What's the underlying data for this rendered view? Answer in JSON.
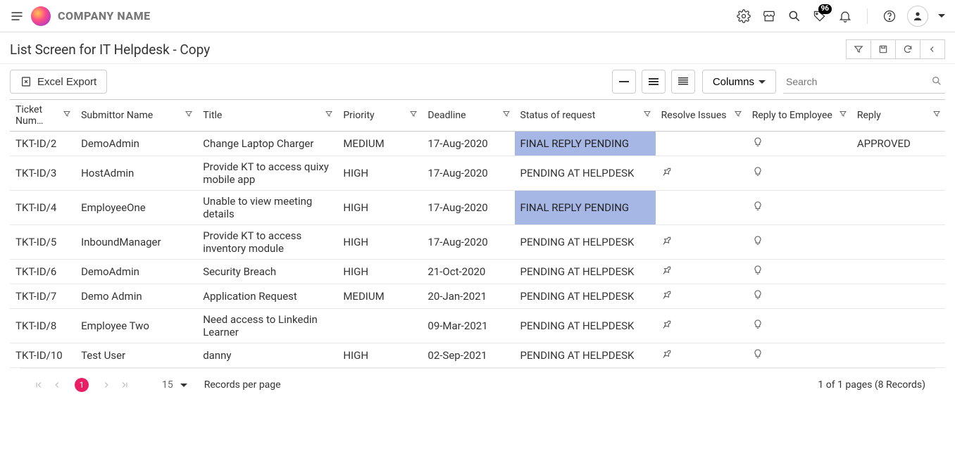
{
  "header": {
    "company": "COMPANY NAME",
    "notification_count": "96"
  },
  "page": {
    "title": "List Screen for IT Helpdesk - Copy"
  },
  "toolbar": {
    "excel_export_label": "Excel Export",
    "columns_label": "Columns",
    "search_placeholder": "Search"
  },
  "columns": {
    "ticket": "Ticket Num…",
    "submitter": "Submittor Name",
    "title": "Title",
    "priority": "Priority",
    "deadline": "Deadline",
    "status": "Status of request",
    "resolve": "Resolve Issues",
    "reply_emp": "Reply to Employee",
    "reply": "Reply"
  },
  "rows": [
    {
      "ticket": "TKT-ID/2",
      "submitter": "DemoAdmin",
      "title": "Change Laptop Charger",
      "priority": "MEDIUM",
      "deadline": "17-Aug-2020",
      "status": "FINAL REPLY PENDING",
      "status_hl": true,
      "pin": false,
      "bulb": true,
      "reply": "APPROVED",
      "two_line": false
    },
    {
      "ticket": "TKT-ID/3",
      "submitter": "HostAdmin",
      "title": "Provide KT to access quixy mobile app",
      "priority": "HIGH",
      "deadline": "17-Aug-2020",
      "status": "PENDING AT HELPDESK",
      "status_hl": false,
      "pin": true,
      "bulb": true,
      "reply": "",
      "two_line": true
    },
    {
      "ticket": "TKT-ID/4",
      "submitter": "EmployeeOne",
      "title": "Unable to view meeting details",
      "priority": "HIGH",
      "deadline": "17-Aug-2020",
      "status": "FINAL REPLY PENDING",
      "status_hl": true,
      "pin": false,
      "bulb": true,
      "reply": "",
      "two_line": true
    },
    {
      "ticket": "TKT-ID/5",
      "submitter": "InboundManager",
      "title": "Provide KT to access inventory module",
      "priority": "HIGH",
      "deadline": "17-Aug-2020",
      "status": "PENDING AT HELPDESK",
      "status_hl": false,
      "pin": true,
      "bulb": true,
      "reply": "",
      "two_line": true
    },
    {
      "ticket": "TKT-ID/6",
      "submitter": "DemoAdmin",
      "title": "Security Breach",
      "priority": "HIGH",
      "deadline": "21-Oct-2020",
      "status": "PENDING AT HELPDESK",
      "status_hl": false,
      "pin": true,
      "bulb": true,
      "reply": "",
      "two_line": false
    },
    {
      "ticket": "TKT-ID/7",
      "submitter": "Demo Admin",
      "title": "Application Request",
      "priority": "MEDIUM",
      "deadline": "20-Jan-2021",
      "status": "PENDING AT HELPDESK",
      "status_hl": false,
      "pin": true,
      "bulb": true,
      "reply": "",
      "two_line": false
    },
    {
      "ticket": "TKT-ID/8",
      "submitter": "Employee Two",
      "title": "Need access to Linkedin Learner",
      "priority": "",
      "deadline": "09-Mar-2021",
      "status": "PENDING AT HELPDESK",
      "status_hl": false,
      "pin": true,
      "bulb": true,
      "reply": "",
      "two_line": true
    },
    {
      "ticket": "TKT-ID/10",
      "submitter": "Test User",
      "title": "danny",
      "priority": "HIGH",
      "deadline": "02-Sep-2021",
      "status": "PENDING AT HELPDESK",
      "status_hl": false,
      "pin": true,
      "bulb": true,
      "reply": "",
      "two_line": false
    }
  ],
  "pagination": {
    "current_page": "1",
    "records_per_page": "15",
    "rpp_label": "Records per page",
    "summary": "1 of 1 pages (8 Records)"
  }
}
